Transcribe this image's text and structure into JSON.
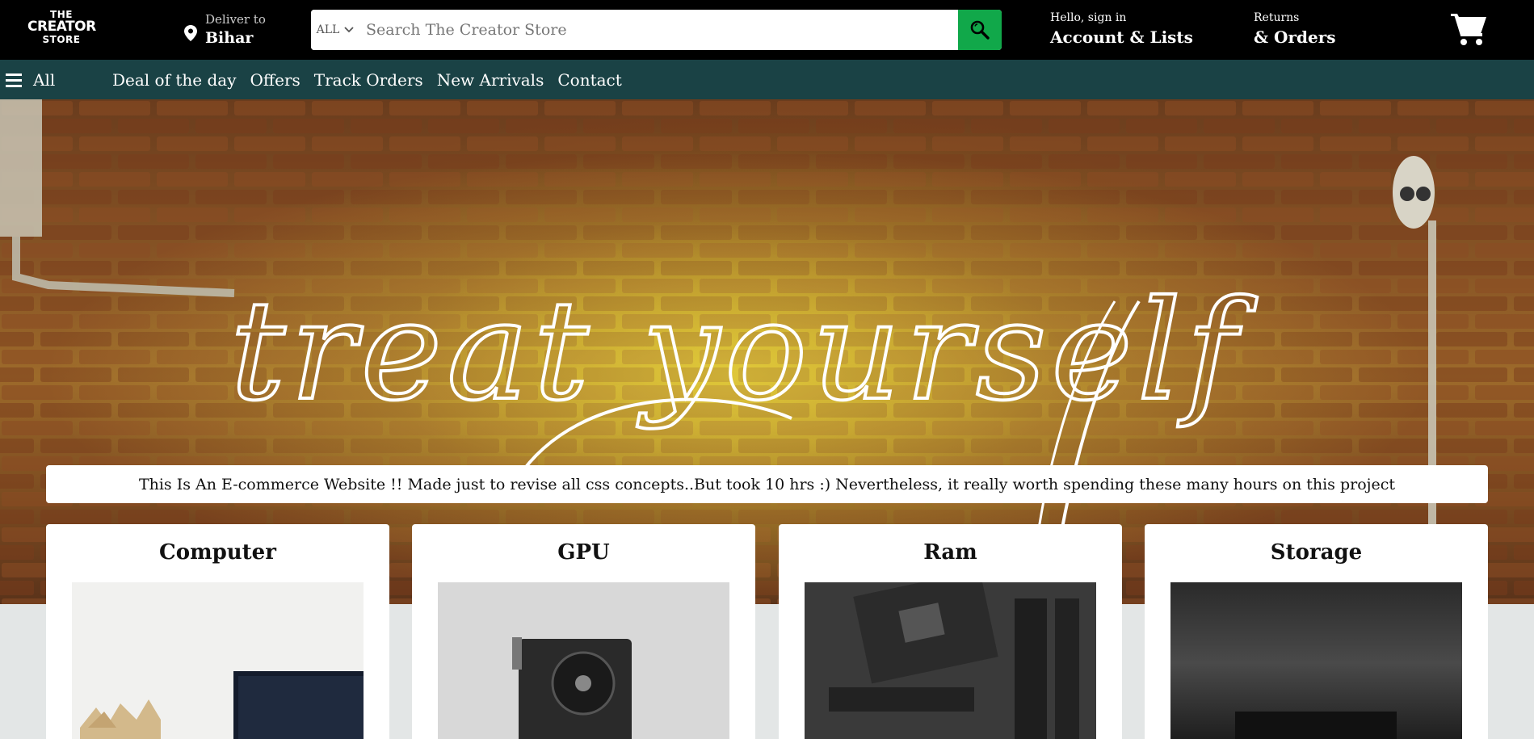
{
  "logo": {
    "line1": "THE",
    "line2": "CREATOR",
    "line3": "STORE"
  },
  "deliver": {
    "label": "Deliver to",
    "location": "Bihar"
  },
  "search": {
    "category": "ALL",
    "placeholder": "Search The Creator Store"
  },
  "account": {
    "greeting": "Hello, sign in",
    "label": "Account & Lists"
  },
  "returns": {
    "label": "Returns",
    "sub": "& Orders"
  },
  "subnav": {
    "all_label": "All",
    "links": [
      "Deal of the day",
      "Offers",
      "Track Orders",
      "New Arrivals",
      "Contact"
    ]
  },
  "hero": {
    "neon_text": "treat yourself",
    "notice": "This Is An E-commerce Website !! Made just to revise all css concepts..But took 10 hrs :) Nevertheless, it really worth spending these many hours on this project"
  },
  "cards": [
    {
      "title": "Computer",
      "image": "computer-desk-photo"
    },
    {
      "title": "GPU",
      "image": "graphics-card-photo"
    },
    {
      "title": "Ram",
      "image": "motherboard-ram-photo"
    },
    {
      "title": "Storage",
      "image": "storage-device-photo"
    }
  ],
  "colors": {
    "navbar_bg": "#000000",
    "subnav_bg": "#1a4245",
    "search_button": "#11a84a",
    "page_bg": "#e3e6e6"
  },
  "icons": {
    "location": "map-pin-icon",
    "dropdown": "chevron-down-icon",
    "search": "search-icon",
    "cart": "shopping-cart-icon",
    "menu": "hamburger-menu-icon"
  }
}
